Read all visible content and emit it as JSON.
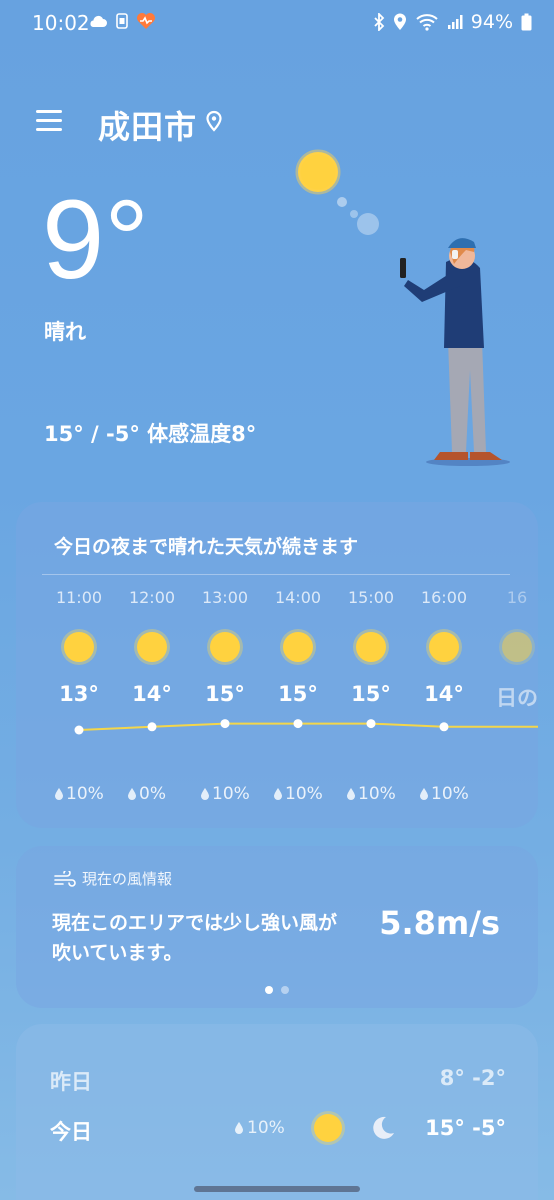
{
  "status": {
    "time": "10:02",
    "battery": "94%",
    "icons": [
      "cloud-icon",
      "sim-icon",
      "heart-app-icon",
      "bluetooth-icon",
      "location-icon",
      "wifi-icon",
      "signal-icon",
      "battery-icon"
    ]
  },
  "header": {
    "city": "成田市"
  },
  "current": {
    "temperature": "9°",
    "condition": "晴れ",
    "range": "15° / -5° 体感温度8°"
  },
  "hourly": {
    "title": "今日の夜まで晴れた天気が続きます",
    "items": [
      {
        "time": "11:00",
        "temp": "13°",
        "pop": "10%",
        "temp_value": 13
      },
      {
        "time": "12:00",
        "temp": "14°",
        "pop": "0%",
        "temp_value": 14
      },
      {
        "time": "13:00",
        "temp": "15°",
        "pop": "10%",
        "temp_value": 15
      },
      {
        "time": "14:00",
        "temp": "15°",
        "pop": "10%",
        "temp_value": 15
      },
      {
        "time": "15:00",
        "temp": "15°",
        "pop": "10%",
        "temp_value": 15
      },
      {
        "time": "16:00",
        "temp": "14°",
        "pop": "10%",
        "temp_value": 14
      },
      {
        "time": "16",
        "temp": "日の",
        "pop": "",
        "temp_value": 14
      }
    ]
  },
  "wind": {
    "header": "現在の風情報",
    "description": "現在このエリアでは少し強い風が吹いています。",
    "speed": "5.8m/s",
    "page_count": 2,
    "page_active": 1
  },
  "daily": {
    "yesterday": {
      "label": "昨日",
      "range": "8° -2°"
    },
    "today": {
      "label": "今日",
      "pop": "10%",
      "range": "15° -5°"
    }
  },
  "colors": {
    "sun": "#ffd23f",
    "temp_line": "#f4d64a"
  }
}
